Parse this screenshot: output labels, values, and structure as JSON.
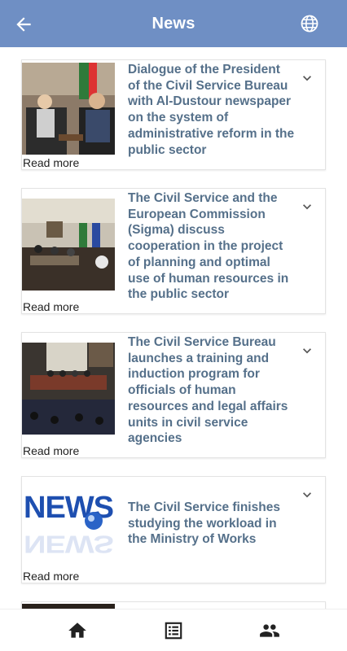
{
  "appbar": {
    "title": "News",
    "back_icon": "arrow-left-icon",
    "language_icon": "globe-icon"
  },
  "news": [
    {
      "title": "Dialogue of the President of the Civil Service Bureau with Al-Dustour newspaper on the system of administrative reform in the public sector",
      "read_more": "Read more",
      "image": "meeting-photo"
    },
    {
      "title": "The Civil Service and the European Commission (Sigma) discuss cooperation in the project of planning and optimal use of human resources in the public sector",
      "read_more": "Read more",
      "image": "conference-room-photo"
    },
    {
      "title": "The Civil Service Bureau launches a training and induction program for officials of human resources and legal affairs units in civil service agencies",
      "read_more": "Read more",
      "image": "training-hall-photo"
    },
    {
      "title": "The Civil Service finishes studying the workload in the Ministry of Works",
      "read_more": "Read more",
      "image": "news-logo-image"
    }
  ],
  "bottom_nav": [
    {
      "icon": "home-icon"
    },
    {
      "icon": "list-icon"
    },
    {
      "icon": "people-icon"
    }
  ],
  "colors": {
    "appbar": "#6f8fc4",
    "title_text": "#55708a"
  }
}
